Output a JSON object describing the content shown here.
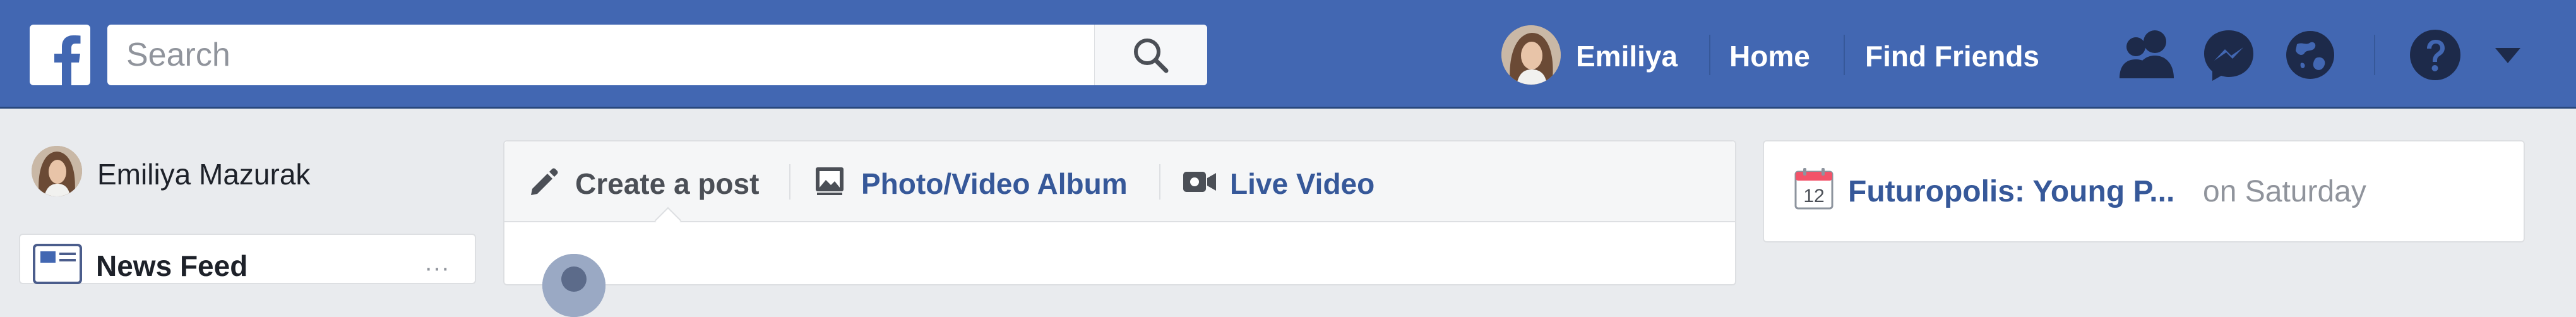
{
  "header": {
    "brand_icon": "facebook-f-logo",
    "search": {
      "placeholder": "Search",
      "value": "",
      "icon": "search-icon"
    },
    "profile_name": "Emiliya",
    "links": [
      "Home",
      "Find Friends"
    ],
    "icons": [
      "friend-requests-icon",
      "messenger-icon",
      "notifications-globe-icon",
      "help-icon",
      "caret-down-icon"
    ],
    "colors": {
      "bar": "#4267b2",
      "bar_border": "#29487d"
    }
  },
  "sidebar": {
    "profile_name": "Emiliya Mazurak",
    "items": [
      {
        "label": "News Feed",
        "icon": "news-feed-icon",
        "more": "···"
      }
    ]
  },
  "composer": {
    "tabs": [
      {
        "label": "Create a post",
        "icon": "pencil-icon"
      },
      {
        "label": "Photo/Video Album",
        "icon": "photo-album-icon"
      },
      {
        "label": "Live Video",
        "icon": "live-video-icon"
      }
    ]
  },
  "event": {
    "calendar_day": "12",
    "title": "Futuropolis: Young P...",
    "when": "on Saturday",
    "colors": {
      "link": "#365899",
      "muted": "#90949c",
      "calendar_top": "#f35369"
    }
  }
}
